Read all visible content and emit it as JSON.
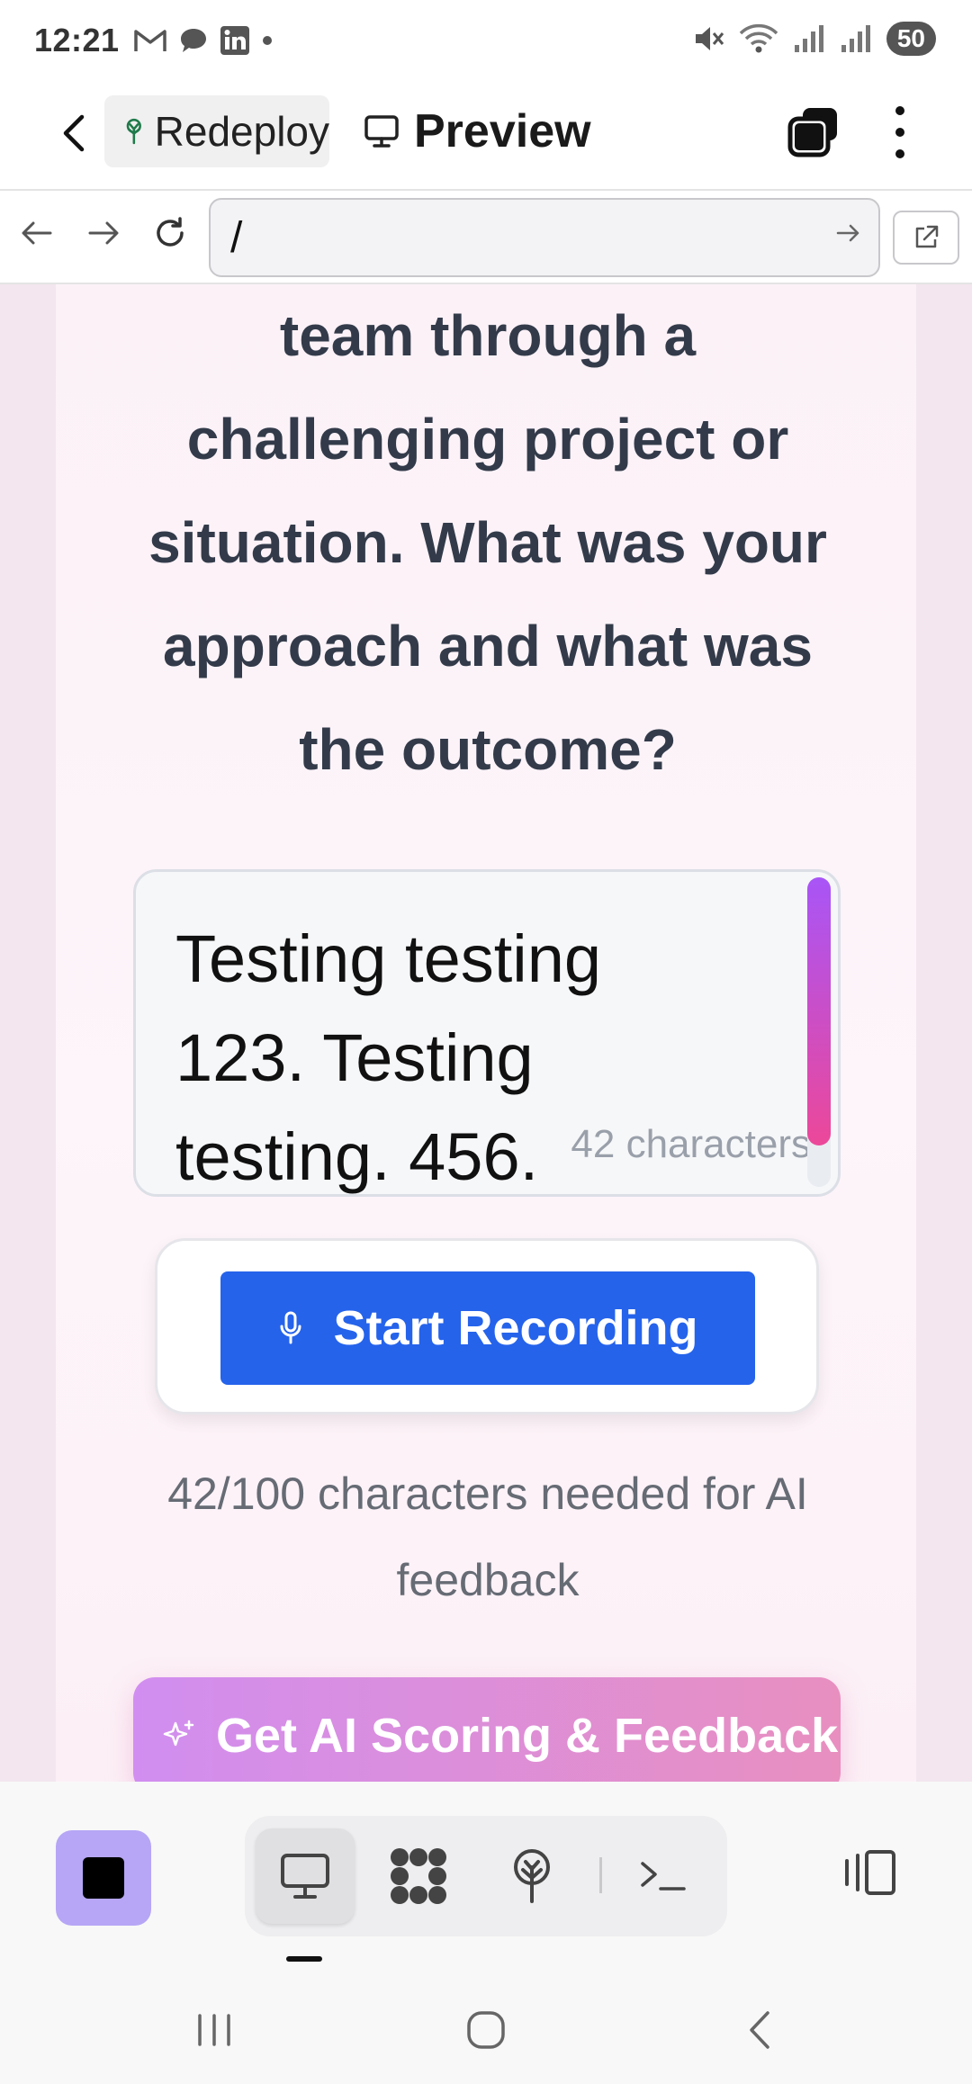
{
  "status_bar": {
    "time": "12:21",
    "battery": "50",
    "left_icons": [
      "gmail-icon",
      "chat-icon",
      "linkedin-icon",
      "dot-icon"
    ],
    "right_icons": [
      "mute-icon",
      "wifi-icon",
      "signal-icon",
      "signal-icon"
    ]
  },
  "app_bar": {
    "redeploy_label": "Redeploy",
    "preview_label": "Preview"
  },
  "url_bar": {
    "value": "/"
  },
  "content": {
    "question": "team through a challenging project or situation. What was your approach and what was the outcome?",
    "answer": "Testing testing 123. Testing testing. 456.",
    "char_count": "42 characters",
    "record_label": "Start Recording",
    "progress_note": "42/100 characters needed for AI feedback",
    "ai_button_label": "Get AI Scoring & Feedback"
  },
  "colors": {
    "record_button": "#2563eb",
    "stop_button": "#b6a6f5",
    "scroll_thumb_start": "#a855f7",
    "scroll_thumb_end": "#ec4899"
  }
}
